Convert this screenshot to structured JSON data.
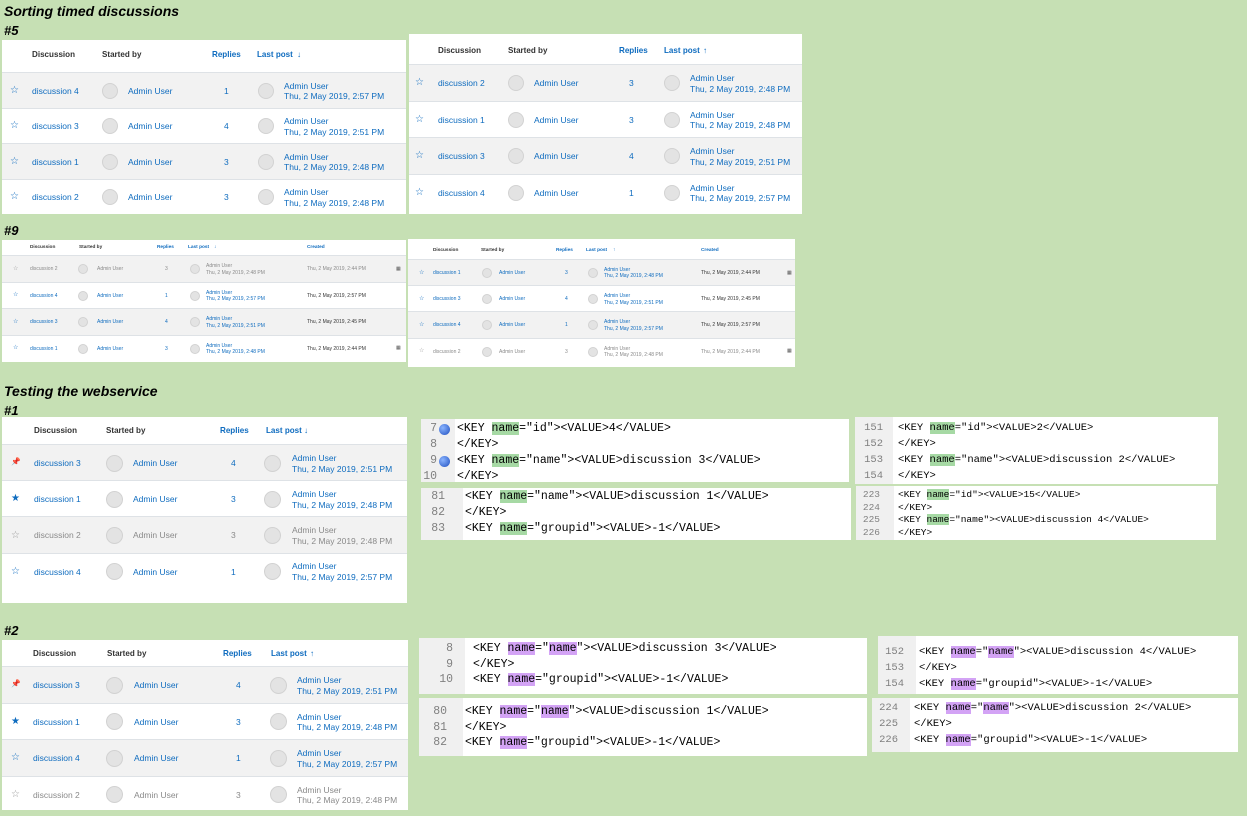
{
  "headings": {
    "title": "Sorting timed discussions",
    "s5": "#5",
    "s9": "#9",
    "testing": "Testing the webservice",
    "s1": "#1",
    "s2": "#2"
  },
  "columns": {
    "discussion": "Discussion",
    "started_by": "Started by",
    "replies": "Replies",
    "last_post": "Last post",
    "created": "Created",
    "arrow_down": "↓",
    "arrow_up": "↑"
  },
  "icons": {
    "star": "star-outline-icon",
    "star_filled": "star-filled-icon",
    "pin": "pin-icon",
    "calendar": "calendar-icon",
    "avatar": "user-avatar-icon"
  },
  "colors": {
    "background": "#c6e0b4",
    "link": "#0f6cbf",
    "highlight_green": "#a6d9a4",
    "highlight_purple": "#d3a3f5"
  },
  "sec5_left": {
    "rows": [
      {
        "name": "discussion 4",
        "user": "Admin User",
        "replies": "1",
        "lp_user": "Admin User",
        "lp_date": "Thu, 2 May 2019, 2:57 PM"
      },
      {
        "name": "discussion 3",
        "user": "Admin User",
        "replies": "4",
        "lp_user": "Admin User",
        "lp_date": "Thu, 2 May 2019, 2:51 PM"
      },
      {
        "name": "discussion 1",
        "user": "Admin User",
        "replies": "3",
        "lp_user": "Admin User",
        "lp_date": "Thu, 2 May 2019, 2:48 PM"
      },
      {
        "name": "discussion 2",
        "user": "Admin User",
        "replies": "3",
        "lp_user": "Admin User",
        "lp_date": "Thu, 2 May 2019, 2:48 PM"
      }
    ]
  },
  "sec5_right": {
    "rows": [
      {
        "name": "discussion 2",
        "user": "Admin User",
        "replies": "3",
        "lp_user": "Admin User",
        "lp_date": "Thu, 2 May 2019, 2:48 PM"
      },
      {
        "name": "discussion 1",
        "user": "Admin User",
        "replies": "3",
        "lp_user": "Admin User",
        "lp_date": "Thu, 2 May 2019, 2:48 PM"
      },
      {
        "name": "discussion 3",
        "user": "Admin User",
        "replies": "4",
        "lp_user": "Admin User",
        "lp_date": "Thu, 2 May 2019, 2:51 PM"
      },
      {
        "name": "discussion 4",
        "user": "Admin User",
        "replies": "1",
        "lp_user": "Admin User",
        "lp_date": "Thu, 2 May 2019, 2:57 PM"
      }
    ]
  },
  "sec9_left": {
    "rows": [
      {
        "name": "discussion 2",
        "user": "Admin User",
        "replies": "3",
        "lp_user": "Admin User",
        "lp_date": "Thu, 2 May 2019, 2:48 PM",
        "created": "Thu, 2 May 2019, 2:44 PM",
        "muted": true,
        "cal": true
      },
      {
        "name": "discussion 4",
        "user": "Admin User",
        "replies": "1",
        "lp_user": "Admin User",
        "lp_date": "Thu, 2 May 2019, 2:57 PM",
        "created": "Thu, 2 May 2019, 2:57 PM",
        "muted": false,
        "cal": false
      },
      {
        "name": "discussion 3",
        "user": "Admin User",
        "replies": "4",
        "lp_user": "Admin User",
        "lp_date": "Thu, 2 May 2019, 2:51 PM",
        "created": "Thu, 2 May 2019, 2:45 PM",
        "muted": false,
        "cal": false
      },
      {
        "name": "discussion 1",
        "user": "Admin User",
        "replies": "3",
        "lp_user": "Admin User",
        "lp_date": "Thu, 2 May 2019, 2:48 PM",
        "created": "Thu, 2 May 2019, 2:44 PM",
        "muted": false,
        "cal": true
      }
    ]
  },
  "sec9_right": {
    "rows": [
      {
        "name": "discussion 1",
        "user": "Admin User",
        "replies": "3",
        "lp_user": "Admin User",
        "lp_date": "Thu, 2 May 2019, 2:48 PM",
        "created": "Thu, 2 May 2019, 2:44 PM",
        "muted": false,
        "cal": true
      },
      {
        "name": "discussion 3",
        "user": "Admin User",
        "replies": "4",
        "lp_user": "Admin User",
        "lp_date": "Thu, 2 May 2019, 2:51 PM",
        "created": "Thu, 2 May 2019, 2:45 PM",
        "muted": false,
        "cal": false
      },
      {
        "name": "discussion 4",
        "user": "Admin User",
        "replies": "1",
        "lp_user": "Admin User",
        "lp_date": "Thu, 2 May 2019, 2:57 PM",
        "created": "Thu, 2 May 2019, 2:57 PM",
        "muted": false,
        "cal": false
      },
      {
        "name": "discussion 2",
        "user": "Admin User",
        "replies": "3",
        "lp_user": "Admin User",
        "lp_date": "Thu, 2 May 2019, 2:48 PM",
        "created": "Thu, 2 May 2019, 2:44 PM",
        "muted": true,
        "cal": true
      }
    ]
  },
  "sec1_table": {
    "rows": [
      {
        "name": "discussion 3",
        "user": "Admin User",
        "replies": "4",
        "lp_user": "Admin User",
        "lp_date": "Thu, 2 May 2019, 2:51 PM",
        "icon": "pin",
        "muted": false
      },
      {
        "name": "discussion 1",
        "user": "Admin User",
        "replies": "3",
        "lp_user": "Admin User",
        "lp_date": "Thu, 2 May 2019, 2:48 PM",
        "icon": "star_filled",
        "muted": false
      },
      {
        "name": "discussion 2",
        "user": "Admin User",
        "replies": "3",
        "lp_user": "Admin User",
        "lp_date": "Thu, 2 May 2019, 2:48 PM",
        "icon": "star",
        "muted": true
      },
      {
        "name": "discussion 4",
        "user": "Admin User",
        "replies": "1",
        "lp_user": "Admin User",
        "lp_date": "Thu, 2 May 2019, 2:57 PM",
        "icon": "star",
        "muted": false
      }
    ]
  },
  "sec2_table": {
    "rows": [
      {
        "name": "discussion 3",
        "user": "Admin User",
        "replies": "4",
        "lp_user": "Admin User",
        "lp_date": "Thu, 2 May 2019, 2:51 PM",
        "icon": "pin",
        "muted": false
      },
      {
        "name": "discussion 1",
        "user": "Admin User",
        "replies": "3",
        "lp_user": "Admin User",
        "lp_date": "Thu, 2 May 2019, 2:48 PM",
        "icon": "star_filled",
        "muted": false
      },
      {
        "name": "discussion 4",
        "user": "Admin User",
        "replies": "1",
        "lp_user": "Admin User",
        "lp_date": "Thu, 2 May 2019, 2:57 PM",
        "icon": "star",
        "muted": false
      },
      {
        "name": "discussion 2",
        "user": "Admin User",
        "replies": "3",
        "lp_user": "Admin User",
        "lp_date": "Thu, 2 May 2019, 2:48 PM",
        "icon": "star",
        "muted": true
      }
    ]
  },
  "code1a": {
    "lines": [
      {
        "n": "7",
        "bp": true,
        "parts": [
          [
            "<KEY ",
            ""
          ],
          [
            "name",
            "g"
          ],
          [
            "=\"id\"><VALUE>4</VALUE>",
            ""
          ]
        ]
      },
      {
        "n": "8",
        "bp": false,
        "parts": [
          [
            "</KEY>",
            ""
          ]
        ]
      },
      {
        "n": "9",
        "bp": true,
        "parts": [
          [
            "<KEY ",
            ""
          ],
          [
            "name",
            "g"
          ],
          [
            "=\"name\"><VALUE>discussion 3</VALUE>",
            ""
          ]
        ]
      },
      {
        "n": "10",
        "bp": false,
        "parts": [
          [
            "</KEY>",
            ""
          ]
        ]
      }
    ]
  },
  "code1b": {
    "lines": [
      {
        "n": "151",
        "parts": [
          [
            "<KEY ",
            ""
          ],
          [
            "name",
            "g"
          ],
          [
            "=\"id\"><VALUE>2</VALUE>",
            ""
          ]
        ]
      },
      {
        "n": "152",
        "parts": [
          [
            "</KEY>",
            ""
          ]
        ]
      },
      {
        "n": "153",
        "parts": [
          [
            "<KEY ",
            ""
          ],
          [
            "name",
            "g"
          ],
          [
            "=\"name\"><VALUE>discussion 2</VALUE>",
            ""
          ]
        ]
      },
      {
        "n": "154",
        "parts": [
          [
            "</KEY>",
            ""
          ]
        ]
      }
    ]
  },
  "code1c": {
    "lines": [
      {
        "n": "81",
        "parts": [
          [
            "<KEY ",
            ""
          ],
          [
            "name",
            "g"
          ],
          [
            "=\"name\"><VALUE>discussion 1</VALUE>",
            ""
          ]
        ]
      },
      {
        "n": "82",
        "parts": [
          [
            "</KEY>",
            ""
          ]
        ]
      },
      {
        "n": "83",
        "parts": [
          [
            "<KEY ",
            ""
          ],
          [
            "name",
            "g"
          ],
          [
            "=\"groupid\"><VALUE>-1</VALUE>",
            ""
          ]
        ]
      }
    ]
  },
  "code1d": {
    "lines": [
      {
        "n": "223",
        "parts": [
          [
            "<KEY ",
            ""
          ],
          [
            "name",
            "g"
          ],
          [
            "=\"id\"><VALUE>15</VALUE>",
            ""
          ]
        ]
      },
      {
        "n": "224",
        "parts": [
          [
            "</KEY>",
            ""
          ]
        ]
      },
      {
        "n": "225",
        "parts": [
          [
            "<KEY ",
            ""
          ],
          [
            "name",
            "g"
          ],
          [
            "=\"name\"><VALUE>discussion 4</VALUE>",
            ""
          ]
        ]
      },
      {
        "n": "226",
        "parts": [
          [
            "</KEY>",
            ""
          ]
        ]
      }
    ]
  },
  "code2a": {
    "lines": [
      {
        "n": "8",
        "parts": [
          [
            "<KEY ",
            ""
          ],
          [
            "name",
            "p"
          ],
          [
            "=\"",
            ""
          ],
          [
            "name",
            "p"
          ],
          [
            "\"><VALUE>discussion 3</VALUE>",
            ""
          ]
        ]
      },
      {
        "n": "9",
        "parts": [
          [
            "</KEY>",
            ""
          ]
        ]
      },
      {
        "n": "10",
        "parts": [
          [
            "<KEY ",
            ""
          ],
          [
            "name",
            "p"
          ],
          [
            "=\"groupid\"><VALUE>-1</VALUE>",
            ""
          ]
        ]
      }
    ]
  },
  "code2b": {
    "lines": [
      {
        "n": "152",
        "parts": [
          [
            "<KEY ",
            ""
          ],
          [
            "name",
            "p"
          ],
          [
            "=\"",
            ""
          ],
          [
            "name",
            "p"
          ],
          [
            "\"><VALUE>discussion 4</VALUE>",
            ""
          ]
        ]
      },
      {
        "n": "153",
        "parts": [
          [
            "</KEY>",
            ""
          ]
        ]
      },
      {
        "n": "154",
        "parts": [
          [
            "<KEY ",
            ""
          ],
          [
            "name",
            "p"
          ],
          [
            "=\"groupid\"><VALUE>-1</VALUE>",
            ""
          ]
        ]
      }
    ]
  },
  "code2c": {
    "lines": [
      {
        "n": "80",
        "parts": [
          [
            "<KEY ",
            ""
          ],
          [
            "name",
            "p"
          ],
          [
            "=\"",
            ""
          ],
          [
            "name",
            "p"
          ],
          [
            "\"><VALUE>discussion 1</VALUE>",
            ""
          ]
        ]
      },
      {
        "n": "81",
        "parts": [
          [
            "</KEY>",
            ""
          ]
        ]
      },
      {
        "n": "82",
        "parts": [
          [
            "<KEY ",
            ""
          ],
          [
            "name",
            "p"
          ],
          [
            "=\"groupid\"><VALUE>-1</VALUE>",
            ""
          ]
        ]
      }
    ]
  },
  "code2d": {
    "lines": [
      {
        "n": "224",
        "parts": [
          [
            "<KEY ",
            ""
          ],
          [
            "name",
            "p"
          ],
          [
            "=\"",
            ""
          ],
          [
            "name",
            "p"
          ],
          [
            "\"><VALUE>discussion 2</VALUE>",
            ""
          ]
        ]
      },
      {
        "n": "225",
        "parts": [
          [
            "</KEY>",
            ""
          ]
        ]
      },
      {
        "n": "226",
        "parts": [
          [
            "<KEY ",
            ""
          ],
          [
            "name",
            "p"
          ],
          [
            "=\"groupid\"><VALUE>-1</VALUE>",
            ""
          ]
        ]
      }
    ]
  }
}
